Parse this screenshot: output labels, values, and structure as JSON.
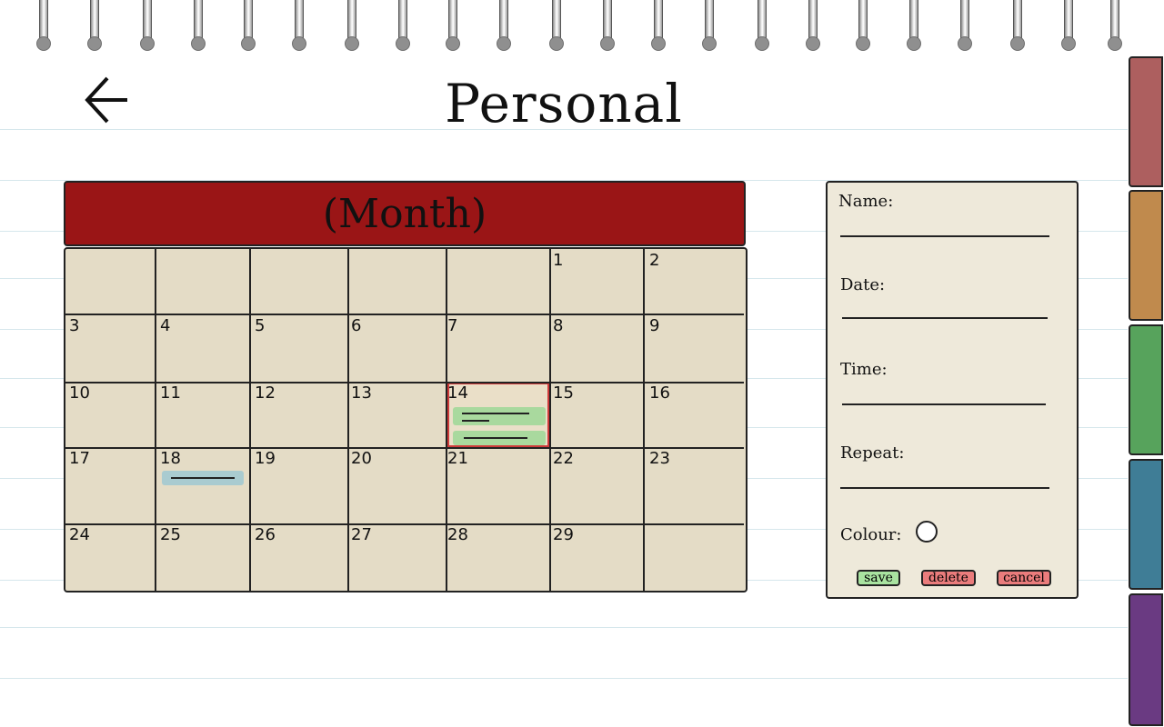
{
  "header": {
    "title": "Personal"
  },
  "calendar": {
    "month_label": "(Month)",
    "weeks": [
      [
        "",
        "",
        "",
        "",
        "",
        "1",
        "2"
      ],
      [
        "3",
        "4",
        "5",
        "6",
        "7",
        "8",
        "9"
      ],
      [
        "10",
        "11",
        "12",
        "13",
        "14",
        "15",
        "16"
      ],
      [
        "17",
        "18",
        "19",
        "20",
        "21",
        "22",
        "23"
      ],
      [
        "24",
        "25",
        "26",
        "27",
        "28",
        "29",
        ""
      ]
    ],
    "selected_day": "14"
  },
  "form": {
    "name_label": "Name:",
    "date_label": "Date:",
    "time_label": "Time:",
    "repeat_label": "Repeat:",
    "colour_label": "Colour:",
    "save_label": "save",
    "delete_label": "delete",
    "cancel_label": "cancel"
  },
  "colors": {
    "month_header": "#9a1516",
    "calendar_bg": "#e4dcc6",
    "event_green": "#a9d99e",
    "event_blue": "#a9cbd0",
    "tabs": [
      "#ad5f5f",
      "#c08a4d",
      "#57a35c",
      "#3f7d96",
      "#6a3a82"
    ]
  },
  "icons": {
    "back": "arrow-left-icon",
    "colour": "circle-icon"
  }
}
